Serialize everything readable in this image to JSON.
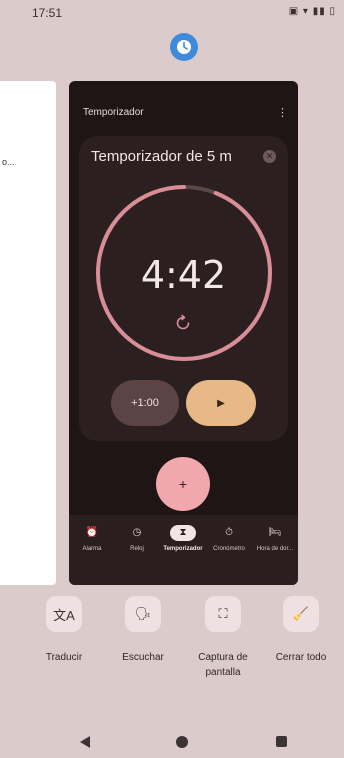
{
  "status_bar": {
    "time": "17:51",
    "icons": "▣ ▾ ▮▮ ▯"
  },
  "left_card": {
    "snippet": "o..."
  },
  "app": {
    "name": "Temporizador",
    "menu_icon": "more-vert-icon",
    "timer": {
      "title": "Temporizador de 5 m",
      "time": "4:42",
      "progress_fraction": 0.94,
      "add_label": "+1:00",
      "play_symbol": "▶",
      "ring_color": "#d98e97",
      "ring_track_color": "#5a4748"
    },
    "fab_label": "+",
    "nav": [
      {
        "label": "Alarma",
        "icon": "alarm-icon",
        "symbol": "⏰"
      },
      {
        "label": "Reloj",
        "icon": "clock-icon",
        "symbol": "◷"
      },
      {
        "label": "Temporizador",
        "icon": "hourglass-icon",
        "symbol": "⧗"
      },
      {
        "label": "Cronómetro",
        "icon": "stopwatch-icon",
        "symbol": "⏱"
      },
      {
        "label": "Hora de dor...",
        "icon": "bed-icon",
        "symbol": "🛏"
      }
    ]
  },
  "actions": [
    {
      "label": "Traducir",
      "icon": "translate-icon",
      "symbol": "文A"
    },
    {
      "label": "Escuchar",
      "icon": "listen-icon",
      "symbol": "🗣"
    },
    {
      "label": "Captura de pantalla",
      "icon": "screenshot-icon",
      "symbol": "⛶"
    },
    {
      "label": "Cerrar todo",
      "icon": "clear-all-icon",
      "symbol": "🧹"
    }
  ]
}
